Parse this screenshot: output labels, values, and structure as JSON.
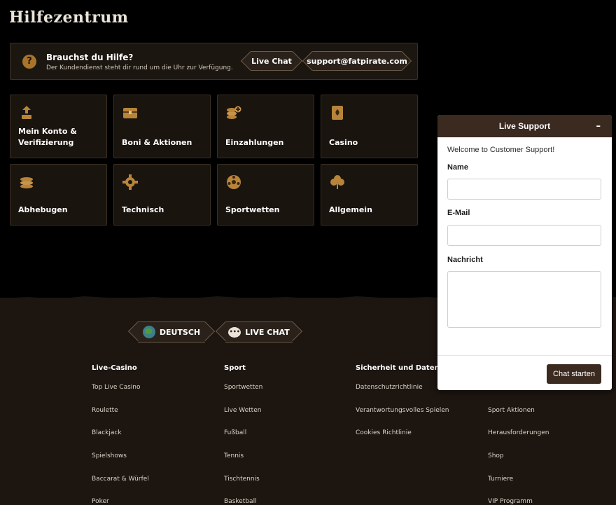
{
  "page": {
    "title": "Hilfezentrum"
  },
  "help_banner": {
    "title": "Brauchst du Hilfe?",
    "subtitle": "Der Kundendienst steht dir rund um die Uhr zur Verfügung.",
    "live_chat_label": "Live Chat",
    "email_label": "support@fatpirate.com"
  },
  "categories": [
    {
      "label": "Mein Konto & Verifizierung",
      "icon": "account-icon"
    },
    {
      "label": "Boni & Aktionen",
      "icon": "treasure-chest-icon"
    },
    {
      "label": "Einzahlungen",
      "icon": "coin-stack-plus-icon"
    },
    {
      "label": "Casino",
      "icon": "playing-card-icon"
    },
    {
      "label": "Abhebugen",
      "icon": "coin-stack-icon"
    },
    {
      "label": "Technisch",
      "icon": "gear-icon"
    },
    {
      "label": "Sportwetten",
      "icon": "football-icon"
    },
    {
      "label": "Allgemein",
      "icon": "clover-icon"
    }
  ],
  "footer": {
    "language_label": "DEUTSCH",
    "live_chat_label": "LIVE CHAT",
    "columns": [
      {
        "title": "Live-Casino",
        "links": [
          "Top Live Casino",
          "Roulette",
          "Blackjack",
          "Spielshows",
          "Baccarat & Würfel",
          "Poker"
        ]
      },
      {
        "title": "Sport",
        "links": [
          "Sportwetten",
          "Live Wetten",
          "Fußball",
          "Tennis",
          "Tischtennis",
          "Basketball"
        ]
      },
      {
        "title": "Sicherheit und Datensc",
        "links": [
          "Datenschutzrichtlinie",
          "Verantwortungsvolles Spielen",
          "Cookies Richtlinie"
        ]
      },
      {
        "title": "",
        "links": [
          "",
          "Sport Aktionen",
          "Herausforderungen",
          "Shop",
          "Turniere",
          "VIP Programm"
        ]
      }
    ]
  },
  "chat": {
    "header_title": "Live Support",
    "minimize_label": "–",
    "welcome": "Welcome to Customer Support!",
    "name_label": "Name",
    "email_label": "E-Mail",
    "message_label": "Nachricht",
    "start_label": "Chat starten"
  },
  "colors": {
    "accent_gold": "#a8742a",
    "card_bg": "#1a140f",
    "chat_brown": "#3b2a20"
  }
}
